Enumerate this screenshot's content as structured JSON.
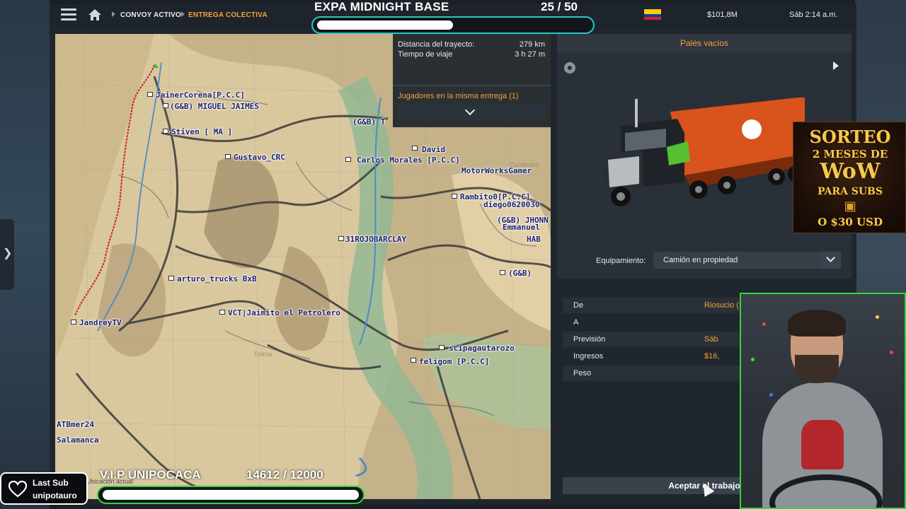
{
  "header": {
    "breadcrumb": [
      "CONVOY ACTIVO",
      "ENTREGA COLECTIVA"
    ],
    "base_title": "EXPA MIDNIGHT BASE",
    "base_count": "25  / 50",
    "base_progress": 0.5,
    "flag": "ecuador-flag",
    "money": "$101,8M",
    "time": "Sáb 2:14 a.m."
  },
  "route": {
    "distance_label": "Distancia del trayecto:",
    "distance_value": "279 km",
    "time_label": "Tiempo de viaje",
    "time_value": "3 h 27 m",
    "players_label": "Jugadores en la misma entrega (1)"
  },
  "map": {
    "players": [
      "JainerCorena[P.C.C]",
      "(G&B) MIGUEL JAIMES",
      "Stiven [ MA ]",
      "Gustavo_CRC",
      "(G&B) T",
      "David",
      "Carlos Morales [P.C.C]",
      "MotorWorksGamer",
      "Rambito0[P.C.C]",
      "diego0620030",
      "(G&B) JHONN",
      "Emmanuel",
      "HAB",
      "31ROJOBARCLAY",
      "(G&B)",
      "arturo_trucks BxB",
      "VCT|Jaimito el Petrolero",
      "JandreyTV",
      "scipagautarozo",
      "feligom [P.C.C]",
      "ATBmer24",
      "Salamanca"
    ],
    "places": [
      "Cundinam",
      "Tolima"
    ],
    "footer": "Ubicación actual"
  },
  "cargo": {
    "title": "Palés vacíos",
    "equip_label": "Equipamiento:",
    "equip_value": "Camión en propiedad"
  },
  "job": {
    "rows": [
      {
        "k": "De",
        "v": "Riosucio ("
      },
      {
        "k": "A",
        "v": ""
      },
      {
        "k": "Previsión",
        "v": "Sáb"
      },
      {
        "k": "Ingresos",
        "v": "$16,"
      },
      {
        "k": "Peso",
        "v": ""
      }
    ],
    "accept": "Aceptar el trabajo"
  },
  "promo": {
    "line1": "SORTEO",
    "line2": "2 MESES DE",
    "line3": "WoW",
    "line4": "PARA SUBS",
    "line5": "O $30 USD"
  },
  "vip": {
    "title": "V.I.P UNIPOCACA",
    "count": "14612  / 12000",
    "progress": 1.0
  },
  "lastsub": {
    "label": "Last Sub",
    "name": "unipotauro"
  },
  "colors": {
    "accent": "#f2a23a",
    "panel": "#20262d",
    "teal_bar": "#29c7c4",
    "green_bar": "#35d33a"
  }
}
